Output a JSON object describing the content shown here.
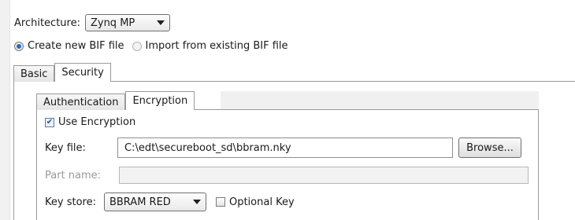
{
  "architecture": {
    "label": "Architecture:",
    "selected": "Zynq MP"
  },
  "bif_mode": {
    "options": [
      {
        "label": "Create new BIF file",
        "selected": true
      },
      {
        "label": "Import from existing BIF file",
        "selected": false
      }
    ]
  },
  "outer_tabs": [
    {
      "label": "Basic",
      "active": false
    },
    {
      "label": "Security",
      "active": true
    }
  ],
  "inner_tabs": [
    {
      "label": "Authentication",
      "active": false
    },
    {
      "label": "Encryption",
      "active": true
    }
  ],
  "encryption": {
    "use_encryption": {
      "label": "Use Encryption",
      "checked": true
    },
    "key_file": {
      "label": "Key file:",
      "value": "C:\\edt\\secureboot_sd\\bbram.nky",
      "browse_label": "Browse..."
    },
    "part_name": {
      "label": "Part name:",
      "value": "",
      "enabled": false
    },
    "key_store": {
      "label": "Key store:",
      "selected": "BBRAM RED"
    },
    "optional_key": {
      "label": "Optional Key",
      "checked": false
    }
  }
}
